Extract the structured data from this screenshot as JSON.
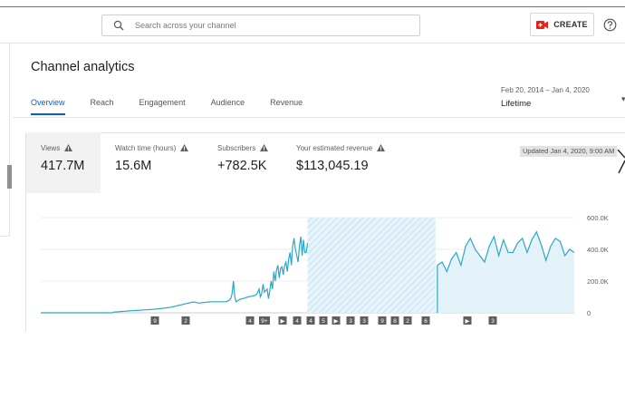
{
  "header": {
    "search_placeholder": "Search across your channel",
    "create_label": "CREATE"
  },
  "page": {
    "title": "Channel analytics",
    "tabs": [
      {
        "label": "Overview",
        "active": true
      },
      {
        "label": "Reach",
        "active": false
      },
      {
        "label": "Engagement",
        "active": false
      },
      {
        "label": "Audience",
        "active": false
      },
      {
        "label": "Revenue",
        "active": false
      }
    ],
    "date_range": "Feb 20, 2014 – Jan 4, 2020",
    "period": "Lifetime"
  },
  "metrics": [
    {
      "label": "Views",
      "value": "417.7M",
      "active": true
    },
    {
      "label": "Watch time (hours)",
      "value": "15.6M",
      "active": false
    },
    {
      "label": "Subscribers",
      "value": "+782.5K",
      "active": false
    },
    {
      "label": "Your estimated revenue",
      "value": "$113,045.19",
      "active": false
    }
  ],
  "updated_text": "Updated Jan 4, 2020, 9:00 AM",
  "colors": {
    "accent": "#065fd4",
    "line": "#2aa7c9",
    "fill": "#e4f2fa",
    "brand_red": "#e62117"
  },
  "chart_data": {
    "type": "area",
    "series": [
      {
        "values": [
          0,
          0,
          0,
          0,
          0,
          0,
          0,
          0,
          0,
          0,
          0,
          0,
          0,
          0,
          0,
          0,
          0,
          0,
          0,
          0,
          0,
          0,
          0,
          0,
          0,
          0,
          0,
          0,
          0,
          0,
          0,
          0,
          0,
          0,
          0,
          0,
          0,
          0,
          0,
          0,
          0,
          0,
          0,
          0,
          0,
          0,
          0,
          0,
          0,
          0,
          0,
          0,
          0,
          0,
          4,
          5,
          6,
          6,
          7,
          8,
          8,
          9,
          10,
          10,
          11,
          12,
          12,
          13,
          13,
          14,
          14,
          15,
          15,
          16,
          16,
          17,
          18,
          18,
          19,
          19,
          20,
          20,
          21,
          22,
          22,
          23,
          24,
          25,
          26,
          27,
          28,
          29,
          30,
          31,
          32,
          33,
          34,
          36,
          38,
          40,
          42,
          44,
          46,
          48,
          50,
          52,
          54,
          56,
          58,
          60,
          62,
          64,
          66,
          67,
          68,
          66,
          64,
          62,
          62,
          63,
          64,
          65,
          66,
          67,
          68,
          68,
          69,
          70,
          70,
          70,
          70,
          70,
          70,
          70,
          70,
          70,
          70,
          70,
          72,
          75,
          80,
          90,
          120,
          200,
          100,
          70,
          75,
          80,
          85,
          88,
          90,
          92,
          95,
          98,
          100,
          102,
          104,
          106,
          108,
          110,
          115,
          130,
          150,
          100,
          120,
          180,
          130,
          140,
          150,
          90,
          140,
          200,
          150,
          260,
          200,
          270,
          300,
          220,
          280,
          290,
          240,
          300,
          320,
          260,
          340,
          380,
          300,
          420,
          470,
          400,
          360,
          320,
          420,
          480,
          360,
          460,
          380,
          380,
          440
        ]
      },
      {
        "values": [
          300,
          320,
          260,
          340,
          380,
          300,
          420,
          470,
          400,
          360,
          320,
          420,
          480,
          360,
          460,
          380,
          380,
          440,
          470,
          380,
          460,
          510,
          430,
          330,
          420,
          470,
          450,
          360,
          400,
          380
        ]
      }
    ],
    "ylim": [
      0,
      600000
    ],
    "y_ticks": [
      "0",
      "200.0K",
      "400.0K",
      "600.0K"
    ],
    "highlight_range": [
      0.5,
      0.74
    ],
    "annotations": [
      "9",
      "2",
      "4",
      "9+",
      "▶",
      "4",
      "4",
      "5",
      "▶",
      "3",
      "3",
      "9",
      "8",
      "2",
      "6",
      "▶",
      "3"
    ]
  }
}
